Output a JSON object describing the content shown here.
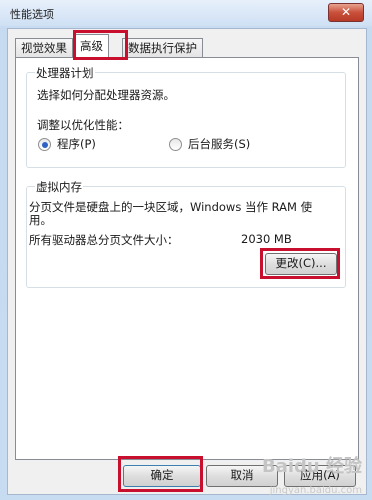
{
  "window": {
    "title": "性能选项",
    "close_glyph": "✕"
  },
  "tabs": [
    {
      "label": "视觉效果"
    },
    {
      "label": "高级"
    },
    {
      "label": "数据执行保护"
    }
  ],
  "processor": {
    "title": "处理器计划",
    "description": "选择如何分配处理器资源。",
    "optimize_label": "调整以优化性能：",
    "options": [
      {
        "label": "程序(P)",
        "checked": true
      },
      {
        "label": "后台服务(S)",
        "checked": false
      }
    ]
  },
  "virtual_memory": {
    "title": "虚拟内存",
    "description_line1": "分页文件是硬盘上的一块区域，Windows 当作 RAM 使",
    "description_line2": "用。",
    "total_label": "所有驱动器总分页文件大小：",
    "total_value": "2030 MB",
    "change_button": "更改(C)..."
  },
  "footer": {
    "ok": "确定",
    "cancel": "取消",
    "apply": "应用(A)"
  },
  "watermark": {
    "text": "Baidu 经验",
    "sub": "jingyan.baidu.com"
  },
  "colors": {
    "highlight": "#c8102e",
    "radio_selected": "#2f62c4"
  }
}
